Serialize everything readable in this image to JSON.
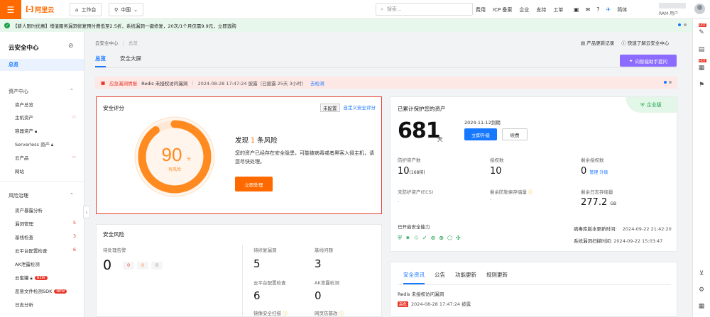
{
  "topbar": {
    "logo_text": "阿里云",
    "workbench": "工作台",
    "region": "中国",
    "search_placeholder": "搜索...",
    "nav": [
      "费用",
      "ICP 备案",
      "企业",
      "支持",
      "工单"
    ],
    "lang": "简体",
    "account_sub": "RAM 用户"
  },
  "promo": {
    "text": "【新人限时优惠】增值服务漏洞修复预付费低至2.5折，系统漏洞一键修复，20次/1个月仅需9.9元，立即选购"
  },
  "sidebar": {
    "title": "云安全中心",
    "overview": "总览",
    "sections": [
      {
        "label": "资产中心",
        "items": [
          "资产总览",
          "主机资产",
          "容器资产",
          "Serverless 资产",
          "云产品",
          "网站"
        ]
      },
      {
        "label": "风险治理",
        "items": [
          "资产暴露分析",
          "漏洞管理",
          "基线检查",
          "云平台配置检查",
          "AK泄露检测",
          "云蜜罐",
          "恶意文件检测SDK",
          "日志分析"
        ]
      }
    ],
    "counts": {
      "vuln": "5",
      "baseline": "3",
      "cloud_config": "6"
    },
    "new_badge": "NEW"
  },
  "breadcrumb": {
    "root": "云安全中心",
    "sep": "/",
    "current": "总览"
  },
  "header_links": {
    "changelog": "产品更新记录",
    "quick_start": "快速了解云安全中心"
  },
  "tabs": [
    "总览",
    "安全大屏"
  ],
  "ai_button": "向智能助手提问",
  "alert": {
    "tag": "应急漏洞情报",
    "vuln": "Redis 未授权访问漏洞",
    "time": "2024-08-28 17:47:24 披露（已披露 25天 3小时）",
    "action": "去检测"
  },
  "score": {
    "title": "安全评分",
    "unconfigured": "未配置",
    "custom_link": "自定义安全评分",
    "value": "90",
    "unit": "分",
    "status": "有风险",
    "gauge_fraction": 0.9,
    "risk_prefix": "发现",
    "risk_count": "1",
    "risk_suffix": "条风险",
    "desc": "您的资产已经存在安全隐患，可能被病毒或者黑客入侵主机，请您尽快处理。",
    "button": "立即处理"
  },
  "security_risk": {
    "title": "安全风险",
    "pending_label": "待处理告警",
    "pending_value": "0",
    "pending_pills": [
      "0",
      "0",
      "0"
    ],
    "metrics": [
      {
        "label": "待修复漏洞",
        "value": "5"
      },
      {
        "label": "基线问题",
        "value": "3"
      },
      {
        "label": "云平台配置检查",
        "value": "6"
      },
      {
        "label": "AK泄露检测",
        "value": "0"
      },
      {
        "label": "镜像安全扫描",
        "value": ""
      },
      {
        "label": "网页防篡改",
        "value": ""
      }
    ]
  },
  "assets": {
    "title": "已累计保护您的资产",
    "edition": "企业版",
    "days": "681",
    "days_unit": "天",
    "expire": "2024-11-12到期",
    "upgrade": "立即升级",
    "renew": "续费",
    "stats": [
      {
        "label": "防护资产数",
        "value": "10",
        "extra": "(168核)"
      },
      {
        "label": "授权数",
        "value": "10",
        "extra": ""
      },
      {
        "label": "剩余授权数",
        "value": "0",
        "extra": "管理  升级"
      },
      {
        "label": "未防护资产(ECS)",
        "value": "-",
        "extra": ""
      },
      {
        "label": "剩余防勒索存储量",
        "value": "-",
        "extra": ""
      },
      {
        "label": "剩余日志存储量",
        "value": "277.2",
        "extra": "GB"
      }
    ],
    "enabled_label": "已开启安全能力",
    "virus_lib_label": "病毒库版本更新时间:",
    "virus_lib_time": "2024-09-22 21:42:20",
    "scan_label": "系统漏洞扫描时间:",
    "scan_time": "2024-09-22 15:03:47"
  },
  "news": {
    "tabs": [
      "安全资讯",
      "公告",
      "功能更新",
      "规则更新"
    ],
    "item_title": "Redis 未授权访问漏洞",
    "item_badge": "高危",
    "item_time": "2024-08-28 17:47:24 披露"
  },
  "colors": {
    "brand": "#ff6a00",
    "primary": "#1677ff",
    "danger": "#e8382b",
    "success": "#19a049"
  }
}
